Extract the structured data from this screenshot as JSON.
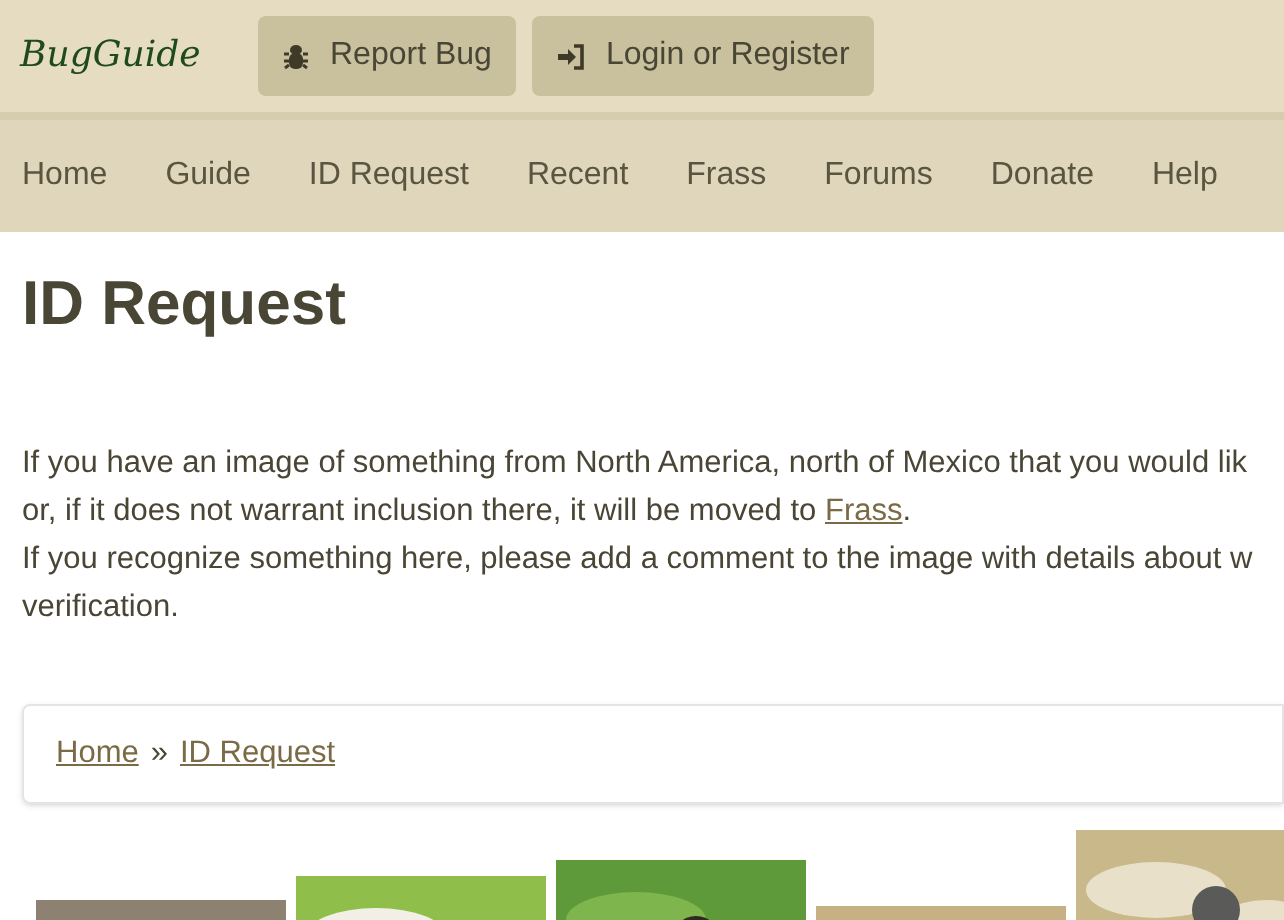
{
  "header": {
    "logo": "BugGuide",
    "buttons": [
      {
        "kind": "bug",
        "label": "Report Bug"
      },
      {
        "kind": "login",
        "label": "Login or Register"
      }
    ]
  },
  "nav": [
    {
      "label": "Home"
    },
    {
      "label": "Guide"
    },
    {
      "label": "ID Request"
    },
    {
      "label": "Recent"
    },
    {
      "label": "Frass"
    },
    {
      "label": "Forums"
    },
    {
      "label": "Donate"
    },
    {
      "label": "Help"
    }
  ],
  "title": "ID Request",
  "intro": [
    {
      "text": "If you have an image of something from North America, north of Mexico that you would lik"
    },
    {
      "text": "or, if it does not warrant inclusion there, it will be moved to ",
      "link": "Frass",
      "after": "."
    },
    {
      "text": "If you recognize something here, please add a comment to the image with details about w"
    },
    {
      "text": "verification."
    }
  ],
  "breadcrumb": [
    {
      "label": "Home"
    },
    {
      "label": "ID Request"
    }
  ],
  "breadcrumb_separator": "»"
}
